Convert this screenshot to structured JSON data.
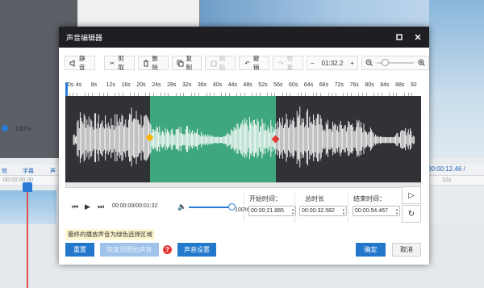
{
  "background": {
    "volume_percent": "100%",
    "toolbar_items": [
      "效",
      "字幕",
      "声"
    ],
    "time_readout": "00:00:12.46 /",
    "ruler_left": "00:00:00.00",
    "ruler_right": "12s"
  },
  "dialog": {
    "title": "声音编辑器",
    "maximize_icon": "maximize-icon",
    "close_icon": "close-icon"
  },
  "toolbar": {
    "mute": "静音",
    "cut": "剪取",
    "delete": "删除",
    "copy": "复制",
    "paste": "粘贴",
    "undo": "撤销",
    "redo": "恢复",
    "zoom_value": "01:32.2"
  },
  "ruler": {
    "ticks": [
      "0s",
      "4s",
      "8s",
      "12s",
      "16s",
      "20s",
      "24s",
      "28s",
      "32s",
      "36s",
      "40s",
      "44s",
      "48s",
      "52s",
      "56s",
      "60s",
      "64s",
      "68s",
      "72s",
      "76s",
      "80s",
      "84s",
      "88s",
      "92"
    ]
  },
  "selection": {
    "start_fraction": 0.238,
    "end_fraction": 0.592
  },
  "player": {
    "time": "00:00:00/00:01:32",
    "volume_percent": "100%",
    "volume_fraction": 1.0
  },
  "times": {
    "start_label": "开始时间：",
    "start_value": "00:00:21.885",
    "duration_label": "总时长",
    "duration_value": "00:00:32.582",
    "end_label": "结束时间：",
    "end_value": "00:00:54.467"
  },
  "hint": "最终的播放声音为绿色选择区域",
  "buttons": {
    "reset": "重置",
    "restore": "恢复到原始声音",
    "settings": "声音设置",
    "ok": "确定",
    "cancel": "取消"
  },
  "colors": {
    "selection": "#3fa77e",
    "waveform_bg": "#303236",
    "accent": "#2378cb",
    "start_handle": "#f4b400",
    "end_handle": "#e53935"
  }
}
